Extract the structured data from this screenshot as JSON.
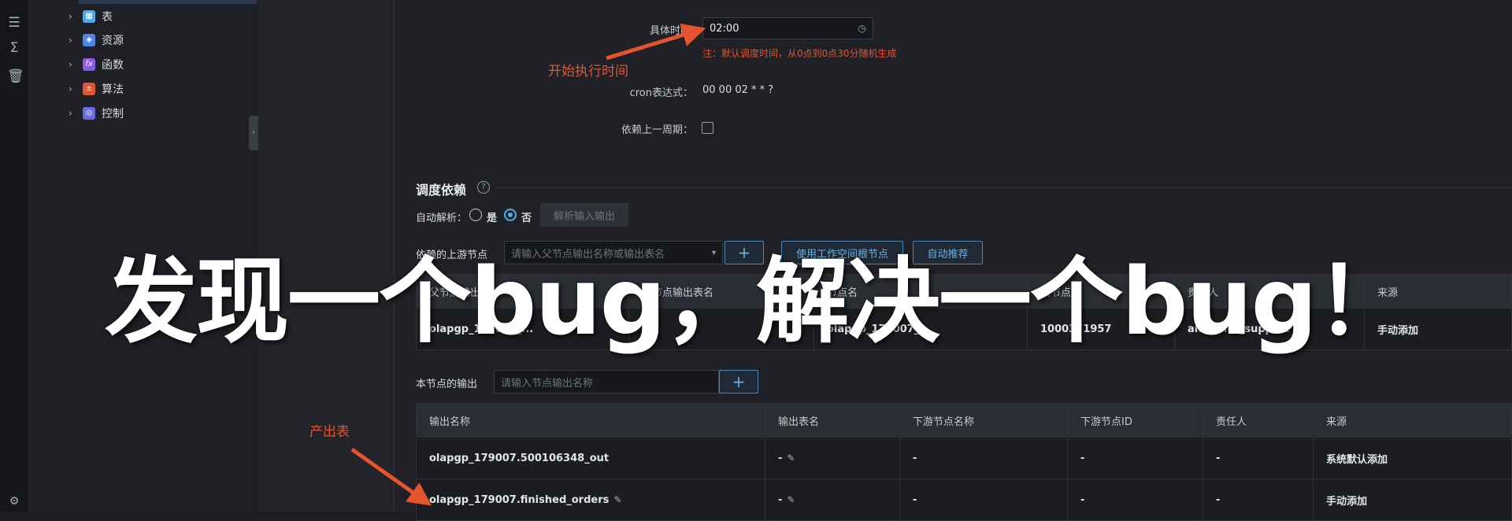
{
  "tree": {
    "items": [
      {
        "label": "表",
        "icon": "table-icon",
        "color": "#4fa9e6"
      },
      {
        "label": "资源",
        "icon": "resource-icon",
        "color": "#4f86e6"
      },
      {
        "label": "函数",
        "icon": "function-icon",
        "color": "#8a5ce6"
      },
      {
        "label": "算法",
        "icon": "algorithm-icon",
        "color": "#e4542e"
      },
      {
        "label": "控制",
        "icon": "control-icon",
        "color": "#6a6ae6"
      }
    ]
  },
  "schedule": {
    "time_label": "具体时间：",
    "time_value": "02:00",
    "time_note": "注：默认调度时间，从0点到0点30分随机生成",
    "cron_label": "cron表达式：",
    "cron_value": "00 00 02 * * ?",
    "depend_last_label": "依赖上一周期："
  },
  "dependency": {
    "title": "调度依赖",
    "auto_parse_label": "自动解析：",
    "radio_yes": "是",
    "radio_no": "否",
    "parse_button": "解析输入输出",
    "upstream_label": "依赖的上游节点",
    "upstream_placeholder": "请输入父节点输出名称或输出表名",
    "use_root_button": "使用工作空间根节点",
    "auto_recommend_button": "自动推荐",
    "upstream_table": {
      "headers": [
        "父节点输出名称",
        "父节点输出表名",
        "节点名",
        "父节点ID",
        "责任人",
        "来源"
      ],
      "rows": [
        [
          "olapgp_179007_...",
          "",
          "olapgp_179007_...",
          "1000371957",
          "analytics_support",
          "手动添加"
        ]
      ]
    },
    "output_label": "本节点的输出",
    "output_placeholder": "请输入节点输出名称",
    "output_table": {
      "headers": [
        "输出名称",
        "输出表名",
        "下游节点名称",
        "下游节点ID",
        "责任人",
        "来源"
      ],
      "rows": [
        [
          "olapgp_179007.500106348_out",
          "-",
          "-",
          "-",
          "-",
          "系统默认添加"
        ],
        [
          "olapgp_179007.finished_orders",
          "-",
          "-",
          "-",
          "-",
          "手动添加"
        ]
      ]
    }
  },
  "annotations": {
    "start_time": "开始执行时间",
    "output_table": "产出表"
  },
  "overlay_title": "发现一个bug，解决一个bug！"
}
